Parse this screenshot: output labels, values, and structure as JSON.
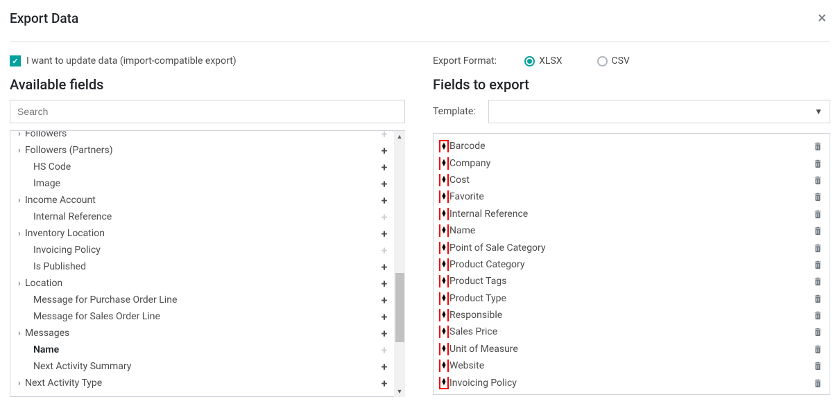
{
  "dialog": {
    "title": "Export Data",
    "update_checkbox_label": "I want to update data (import-compatible export)",
    "update_checked": true
  },
  "left": {
    "available_title": "Available fields",
    "search_placeholder": "Search",
    "tree": [
      {
        "label": "Followers",
        "expandable": true,
        "indent": false,
        "plus": "faded",
        "clipped_top": true
      },
      {
        "label": "Followers (Partners)",
        "expandable": true,
        "indent": false,
        "plus": "normal"
      },
      {
        "label": "HS Code",
        "expandable": false,
        "indent": true,
        "plus": "normal"
      },
      {
        "label": "Image",
        "expandable": false,
        "indent": true,
        "plus": "normal"
      },
      {
        "label": "Income Account",
        "expandable": true,
        "indent": false,
        "plus": "normal"
      },
      {
        "label": "Internal Reference",
        "expandable": false,
        "indent": true,
        "plus": "faded"
      },
      {
        "label": "Inventory Location",
        "expandable": true,
        "indent": false,
        "plus": "normal"
      },
      {
        "label": "Invoicing Policy",
        "expandable": false,
        "indent": true,
        "plus": "faded"
      },
      {
        "label": "Is Published",
        "expandable": false,
        "indent": true,
        "plus": "normal"
      },
      {
        "label": "Location",
        "expandable": true,
        "indent": false,
        "plus": "normal"
      },
      {
        "label": "Message for Purchase Order Line",
        "expandable": false,
        "indent": true,
        "plus": "normal"
      },
      {
        "label": "Message for Sales Order Line",
        "expandable": false,
        "indent": true,
        "plus": "normal"
      },
      {
        "label": "Messages",
        "expandable": true,
        "indent": false,
        "plus": "normal"
      },
      {
        "label": "Name",
        "expandable": false,
        "indent": true,
        "plus": "faded",
        "bold": true
      },
      {
        "label": "Next Activity Summary",
        "expandable": false,
        "indent": true,
        "plus": "normal"
      },
      {
        "label": "Next Activity Type",
        "expandable": true,
        "indent": false,
        "plus": "normal"
      }
    ]
  },
  "right": {
    "format_label": "Export Format:",
    "format_options": {
      "xlsx": "XLSX",
      "csv": "CSV"
    },
    "format_selected": "xlsx",
    "fields_title": "Fields to export",
    "template_label": "Template:",
    "fields": [
      "Barcode",
      "Company",
      "Cost",
      "Favorite",
      "Internal Reference",
      "Name",
      "Point of Sale Category",
      "Product Category",
      "Product Tags",
      "Product Type",
      "Responsible",
      "Sales Price",
      "Unit of Measure",
      "Website",
      "Invoicing Policy"
    ]
  }
}
